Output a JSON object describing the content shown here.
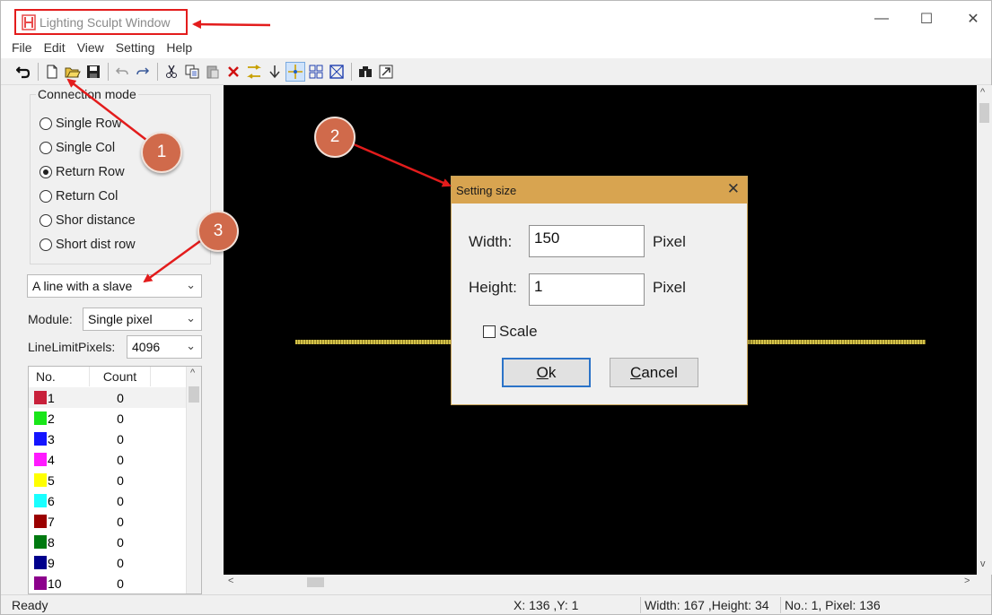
{
  "window": {
    "title": "Lighting Sculpt Window",
    "controls": {
      "minimize": "—",
      "maximize": "☐",
      "close": "✕"
    }
  },
  "menu": [
    "File",
    "Edit",
    "View",
    "Setting",
    "Help"
  ],
  "toolbar": {
    "buttons": [
      "undo-arrow-icon",
      "new-file-icon",
      "open-folder-icon",
      "save-icon",
      "undo-icon",
      "redo-icon",
      "cut-icon",
      "copy-icon",
      "paste-icon",
      "delete-icon",
      "transform-icon",
      "download-arrow-icon",
      "crosshair-icon",
      "grid-icon",
      "box-x-icon",
      "binoculars-icon",
      "export-icon"
    ]
  },
  "left_panel": {
    "connection_mode": {
      "label": "Connection mode",
      "options": [
        "Single Row",
        "Single Col",
        "Return Row",
        "Return Col",
        "Shor distance",
        "Short dist row"
      ],
      "selected": "Return Row"
    },
    "line_combo": {
      "value": "A line with a slave"
    },
    "module": {
      "label": "Module:",
      "value": "Single pixel"
    },
    "line_limit": {
      "label": "LineLimitPixels:",
      "value": "4096"
    },
    "list": {
      "columns": [
        "No.",
        "Count"
      ],
      "rows": [
        {
          "no": "1",
          "count": "0",
          "color": "#c8203a"
        },
        {
          "no": "2",
          "count": "0",
          "color": "#19e619"
        },
        {
          "no": "3",
          "count": "0",
          "color": "#1414ff"
        },
        {
          "no": "4",
          "count": "0",
          "color": "#ff1aff"
        },
        {
          "no": "5",
          "count": "0",
          "color": "#ffff00"
        },
        {
          "no": "6",
          "count": "0",
          "color": "#19ffff"
        },
        {
          "no": "7",
          "count": "0",
          "color": "#9b0000"
        },
        {
          "no": "8",
          "count": "0",
          "color": "#007a10"
        },
        {
          "no": "9",
          "count": "0",
          "color": "#00008c"
        },
        {
          "no": "10",
          "count": "0",
          "color": "#8c008c"
        }
      ]
    }
  },
  "dialog": {
    "title": "Setting size",
    "width_label": "Width:",
    "width_value": "150",
    "height_label": "Height:",
    "height_value": "1",
    "unit": "Pixel",
    "scale_label": "Scale",
    "ok_mnemonic": "O",
    "ok_rest": "k",
    "cancel_mnemonic": "C",
    "cancel_rest": "ancel"
  },
  "statusbar": {
    "ready": "Ready",
    "coords": "X: 136 ,Y: 1",
    "size": "Width: 167 ,Height: 34",
    "pixel": "No.: 1, Pixel: 136"
  },
  "annotations": [
    "1",
    "2",
    "3"
  ],
  "colors": {
    "annotation": "#d06a4b",
    "arrow": "#e31c1c",
    "dialog_title": "#d8a450",
    "canvas": "#000000"
  }
}
